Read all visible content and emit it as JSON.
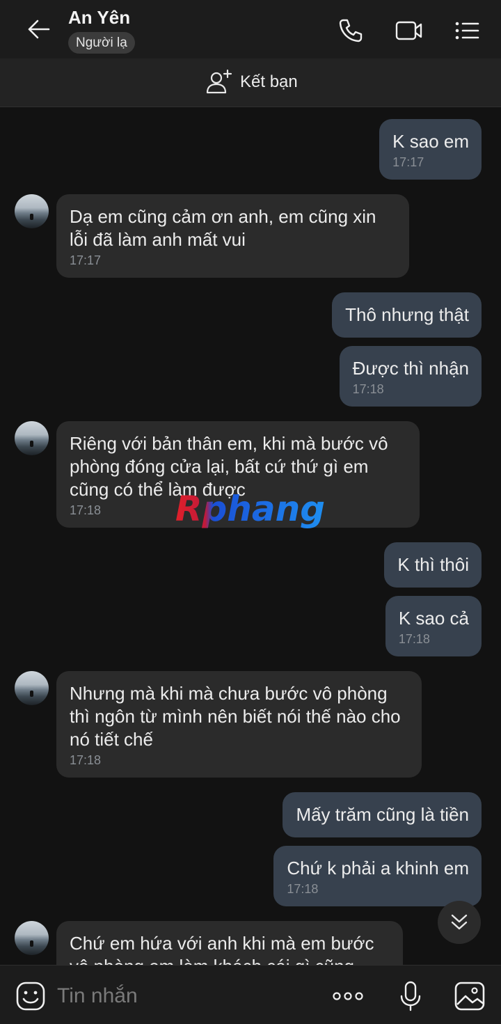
{
  "header": {
    "name": "An Yên",
    "badge": "Người lạ",
    "icons": [
      "back-arrow-icon",
      "phone-icon",
      "video-call-icon",
      "menu-icon"
    ]
  },
  "friend_bar": {
    "label": "Kết bạn",
    "icon": "add-friend-icon"
  },
  "messages": [
    {
      "dir": "out",
      "text": "K sao em",
      "time": "17:17"
    },
    {
      "dir": "in",
      "text": "Dạ em cũng cảm ơn anh, em cũng xin lỗi đã làm anh mất vui",
      "time": "17:17"
    },
    {
      "dir": "out",
      "text": "Thô nhưng thật",
      "time": ""
    },
    {
      "dir": "out",
      "text": "Được thì nhận",
      "time": "17:18"
    },
    {
      "dir": "in",
      "text": "Riêng với bản thân em, khi mà bước vô phòng đóng cửa lại, bất cứ thứ gì em cũng có thể làm được",
      "time": "17:18"
    },
    {
      "dir": "out",
      "text": "K thì thôi",
      "time": ""
    },
    {
      "dir": "out",
      "text": "K sao cả",
      "time": "17:18"
    },
    {
      "dir": "in",
      "text": "Nhưng mà khi mà chưa bước vô phòng thì ngôn từ mình nên biết nói thế nào cho nó tiết chế",
      "time": "17:18"
    },
    {
      "dir": "out",
      "text": "Mấy trăm cũng là tiền",
      "time": ""
    },
    {
      "dir": "out",
      "text": "Chứ k phải a khinh em",
      "time": "17:18"
    },
    {
      "dir": "in",
      "text": "Chứ em hứa với anh khi mà em bước vô phòng em làm khách cái gì cũng",
      "time": ""
    }
  ],
  "watermark": {
    "text": "Rphang"
  },
  "composer": {
    "placeholder": "Tin nhắn",
    "icons": [
      "emoji-icon",
      "more-icon",
      "microphone-icon",
      "image-icon"
    ]
  },
  "colors": {
    "background": "#121212",
    "header": "#1c1c1c",
    "incoming_bubble": "#2b2b2b",
    "outgoing_bubble": "#37414e",
    "time": "#8a8f95"
  }
}
